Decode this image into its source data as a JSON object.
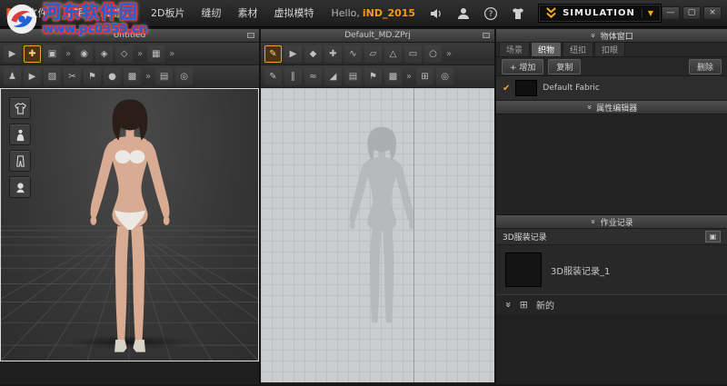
{
  "colors": {
    "accent_orange": "#f0a030",
    "watermark_blue": "#1f62d6",
    "watermark_red": "#dd3a3a"
  },
  "watermark": {
    "title": "河东软件园",
    "url": "www.pc0359.cn"
  },
  "icons": {
    "collapse": "»",
    "check": "✔",
    "plus_box": "⊞",
    "panel": "▣",
    "min": "—",
    "max": "▢",
    "close": "×"
  },
  "menubar": {
    "logo": "M",
    "items": [
      {
        "name": "menu-file",
        "label": "文件"
      },
      {
        "name": "menu-edit",
        "label": "编辑"
      },
      {
        "name": "menu-3d-garment",
        "label": "3D服装"
      },
      {
        "name": "menu-2d-pattern",
        "label": "2D板片"
      },
      {
        "name": "menu-sewing",
        "label": "缝纫"
      },
      {
        "name": "menu-material",
        "label": "素材"
      },
      {
        "name": "menu-avatar",
        "label": "虚拟模特"
      }
    ],
    "greeting": "Hello,",
    "username": "iND_2015",
    "simulation_label": "SIMULATION"
  },
  "left_panel": {
    "title": "Untitled",
    "toolbar1": [
      {
        "name": "gizmo-select-icon",
        "glyph": "▶"
      },
      {
        "name": "gizmo-move-icon",
        "glyph": "✚",
        "active": true
      },
      {
        "name": "show-2d-window-icon",
        "glyph": "▣"
      },
      {
        "name": "toolbar-overflow-icon",
        "glyph": "»",
        "sep": true
      },
      {
        "name": "arrangement-points-icon",
        "glyph": "◉"
      },
      {
        "name": "pin-icon",
        "glyph": "◈"
      },
      {
        "name": "fold-arrangement-icon",
        "glyph": "◇"
      },
      {
        "name": "toolbar-overflow-icon-2",
        "glyph": "»",
        "sep": true
      },
      {
        "name": "sync-window-icon",
        "glyph": "▦"
      },
      {
        "name": "toolbar-overflow-icon-3",
        "glyph": "»",
        "sep": true
      }
    ],
    "toolbar2": [
      {
        "name": "avatar-pose-icon",
        "glyph": "♟"
      },
      {
        "name": "select-mesh-icon",
        "glyph": "▶"
      },
      {
        "name": "measure-tape-icon",
        "glyph": "▧"
      },
      {
        "name": "scissors-icon",
        "glyph": "✂"
      },
      {
        "name": "pin-flag-icon",
        "glyph": "⚑"
      },
      {
        "name": "texture-sphere-icon",
        "glyph": "●"
      },
      {
        "name": "checkerboard-icon",
        "glyph": "▩"
      },
      {
        "name": "toolbar-overflow-icon",
        "glyph": "»",
        "sep": true
      },
      {
        "name": "display-mode-icon",
        "glyph": "▤"
      },
      {
        "name": "camera-view-icon",
        "glyph": "◎"
      }
    ]
  },
  "center_panel": {
    "title": "Default_MD.ZPrj",
    "toolbar1": [
      {
        "name": "transform-pattern-icon",
        "glyph": "✎",
        "active": true
      },
      {
        "name": "edit-pattern-icon",
        "glyph": "▶"
      },
      {
        "name": "edit-point-line-icon",
        "glyph": "◆"
      },
      {
        "name": "add-point-icon",
        "glyph": "✚"
      },
      {
        "name": "edit-curvature-icon",
        "glyph": "∿"
      },
      {
        "name": "internal-shape-icon",
        "glyph": "▱"
      },
      {
        "name": "polygon-tool-icon",
        "glyph": "△"
      },
      {
        "name": "rectangle-tool-icon",
        "glyph": "▭"
      },
      {
        "name": "circle-tool-icon",
        "glyph": "○"
      },
      {
        "name": "toolbar-overflow-icon",
        "glyph": "»",
        "sep": true
      }
    ],
    "toolbar2": [
      {
        "name": "edit-sewing-icon",
        "glyph": "✎"
      },
      {
        "name": "segment-sewing-icon",
        "glyph": "∥"
      },
      {
        "name": "free-sewing-icon",
        "glyph": "≈"
      },
      {
        "name": "fold-press-icon",
        "glyph": "◢"
      },
      {
        "name": "iron-tool-icon",
        "glyph": "▤"
      },
      {
        "name": "tack-icon",
        "glyph": "⚑"
      },
      {
        "name": "grading-icon",
        "glyph": "▩"
      },
      {
        "name": "toolbar-overflow-icon",
        "glyph": "»",
        "sep": true
      },
      {
        "name": "snap-grid-icon",
        "glyph": "⊞"
      },
      {
        "name": "measure-icon",
        "glyph": "◎"
      }
    ]
  },
  "right_panel": {
    "object_window": {
      "title": "物体窗口",
      "tabs": [
        {
          "name": "tab-scene",
          "label": "场景"
        },
        {
          "name": "tab-fabric",
          "label": "织物",
          "active": true
        },
        {
          "name": "tab-button",
          "label": "纽扣"
        },
        {
          "name": "tab-buttonhole",
          "label": "扣眼"
        }
      ],
      "add_label": "+ 增加",
      "copy_label": "复制",
      "delete_label": "删除",
      "fabric_name": "Default Fabric"
    },
    "property_editor": {
      "title": "属性编辑器"
    },
    "job_record": {
      "title": "作业记录",
      "section_label": "3D服装记录",
      "item_label": "3D服装记录_1",
      "new_label": "新的"
    }
  }
}
